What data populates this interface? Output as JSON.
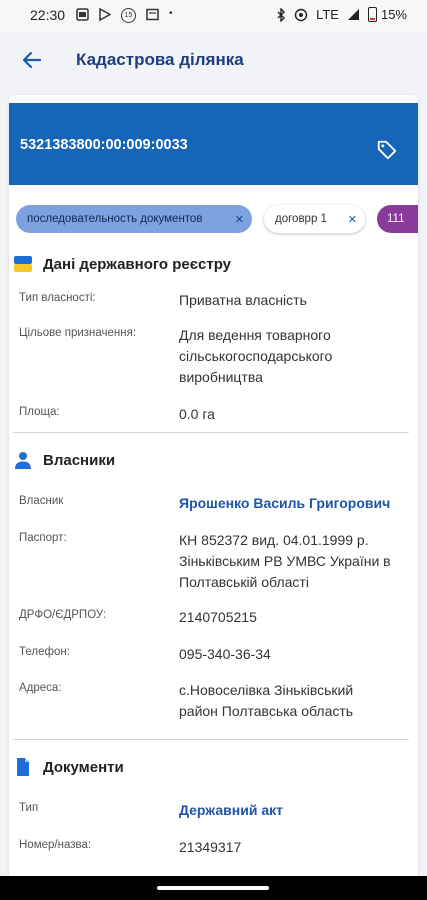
{
  "status_bar": {
    "time": "22:30",
    "network": "LTE",
    "battery": "15%",
    "icons": [
      "gallery-icon",
      "play-icon",
      "badge-15-icon",
      "news-icon",
      "dot-icon",
      "bluetooth-icon",
      "wifi-call-icon",
      "signal-icon",
      "battery-icon"
    ],
    "badge": "15"
  },
  "app_bar": {
    "title": "Кадастрова ділянка"
  },
  "parcel": {
    "cadastral_number": "5321383800:00:009:0033",
    "banner_color": "#1765b8"
  },
  "chips": [
    {
      "label": "последовательность документов"
    },
    {
      "label": "договрр 1"
    },
    {
      "label": "111"
    }
  ],
  "registry": {
    "heading": "Дані державного реєстру",
    "rows": [
      {
        "label": "Тип власності:",
        "value": "Приватна власність"
      },
      {
        "label": "Цільове призначення:",
        "value": "Для ведення товарного сільськогосподарського виробництва"
      },
      {
        "label": "Площа:",
        "value": "0.0 га"
      }
    ]
  },
  "owners": {
    "heading": "Власники",
    "rows": [
      {
        "label": "Власник",
        "value": "Ярошенко Василь Григорович"
      },
      {
        "label": "Паспорт:",
        "value": "КН 852372 вид. 04.01.1999 р. Зіньківським РВ УМВС України в Полтавській області"
      },
      {
        "label": "ДРФО/ЄДРПОУ:",
        "value": "2140705215"
      },
      {
        "label": "Телефон:",
        "value": "095-340-36-34"
      },
      {
        "label": "Адреса:",
        "value": "с.Новоселівка Зіньківський район Полтавська область"
      }
    ]
  },
  "documents": {
    "heading": "Документи",
    "rows": [
      {
        "label": "Тип",
        "value": "Державний акт"
      },
      {
        "label": "Номер/назва:",
        "value": "21349317"
      }
    ]
  },
  "colors": {
    "accent": "#1765b8",
    "title": "#1d3f82",
    "link": "#1d56a8",
    "chip_blue": "#7ea2e0",
    "chip_purple": "#8a3a9a"
  }
}
